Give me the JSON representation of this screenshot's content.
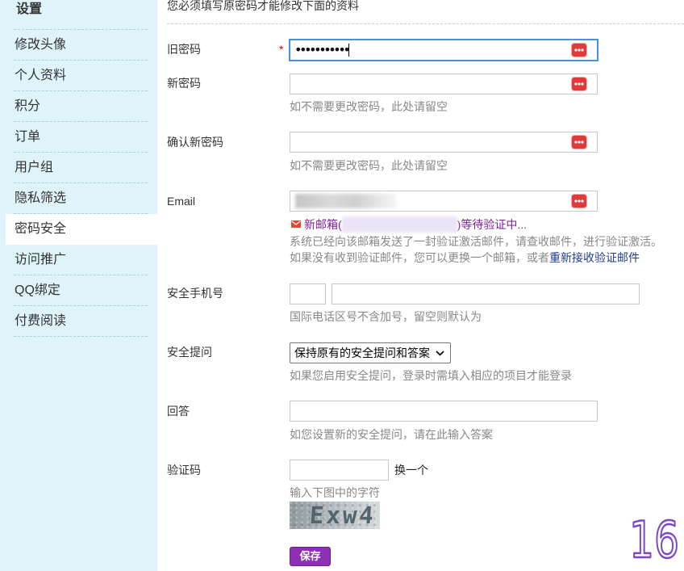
{
  "colors": {
    "sidebar_bg": "#def3fa",
    "accent_purple": "#8e2fb6",
    "accent_purple_border": "#6e1e92",
    "required_red": "#e00000",
    "link_blue": "#223f8e",
    "pending_purple": "#7b1f98",
    "focus_blue": "#4c8fdb",
    "hint_grey": "#888888",
    "icon_red": "#e03b3b"
  },
  "icons": {
    "password_field": "password-dots-icon",
    "email_pending": "envelope-icon",
    "select_arrow": "chevron-down-icon"
  },
  "sidebar": {
    "title": "设置",
    "items": [
      {
        "label": "修改头像"
      },
      {
        "label": "个人资料"
      },
      {
        "label": "积分"
      },
      {
        "label": "订单"
      },
      {
        "label": "用户组"
      },
      {
        "label": "隐私筛选"
      },
      {
        "label": "密码安全",
        "selected": true
      },
      {
        "label": "访问推广"
      },
      {
        "label": "QQ绑定"
      },
      {
        "label": "付费阅读"
      }
    ]
  },
  "notice": "您必须填写原密码才能修改下面的资料",
  "form": {
    "old_password": {
      "label": "旧密码",
      "required_mark": "*",
      "value_masked": "•••••••••••",
      "focused": true
    },
    "new_password": {
      "label": "新密码",
      "hint": "如不需要更改密码，此处请留空"
    },
    "confirm_password": {
      "label": "确认新密码",
      "hint": "如不需要更改密码，此处请留空"
    },
    "email": {
      "label": "Email",
      "pending_prefix": "新邮箱(",
      "pending_suffix": ")等待验证中...",
      "sent_notice": "系统已经向该邮箱发送了一封验证激活邮件，请查收邮件，进行验证激活。",
      "resend_prefix": "如果没有收到验证邮件，您可以更换一个邮箱，或者",
      "resend_link": "重新接收验证邮件"
    },
    "phone": {
      "label": "安全手机号",
      "hint": "国际电话区号不含加号，留空则默认为"
    },
    "security_question": {
      "label": "安全提问",
      "selected_option": "保持原有的安全提问和答案",
      "hint": "如果您启用安全提问，登录时需填入相应的项目才能登录"
    },
    "answer": {
      "label": "回答",
      "hint": "如您设置新的安全提问，请在此输入答案"
    },
    "captcha": {
      "label": "验证码",
      "refresh_label": "换一个",
      "hint": "输入下图中的字符",
      "image_text": "Exw4"
    },
    "save_label": "保存"
  },
  "corner_number": "16"
}
